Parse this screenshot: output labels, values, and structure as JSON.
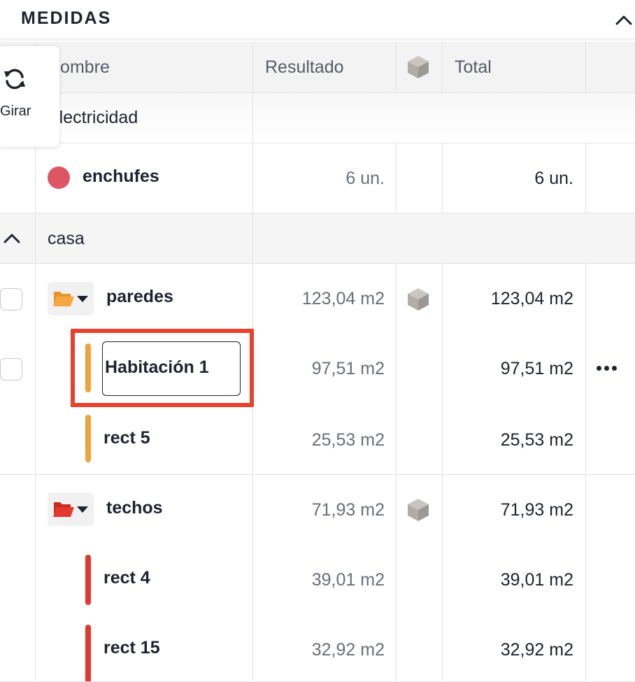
{
  "panel": {
    "title": "MEDIDAS"
  },
  "toolbar": {
    "rotate_label": "Girar"
  },
  "columns": {
    "name": "Nombre",
    "result": "Resultado",
    "total": "Total"
  },
  "groups": [
    {
      "label": "Electricidad",
      "items": [
        {
          "name": "enchufes",
          "result": "6 un.",
          "total": "6 un.",
          "color": "#de5563"
        }
      ]
    },
    {
      "label": "casa",
      "folders": [
        {
          "name": "paredes",
          "result": "123,04 m2",
          "total": "123,04 m2",
          "color": "#f0a33a",
          "children": [
            {
              "name": "Habitación 1",
              "result": "97,51 m2",
              "total": "97,51 m2"
            },
            {
              "name": "rect 5",
              "result": "25,53 m2",
              "total": "25,53 m2"
            }
          ]
        },
        {
          "name": "techos",
          "result": "71,93 m2",
          "total": "71,93 m2",
          "color": "#e3382d",
          "children": [
            {
              "name": "rect 4",
              "result": "39,01 m2",
              "total": "39,01 m2"
            },
            {
              "name": "rect 15",
              "result": "32,92 m2",
              "total": "32,92 m2"
            }
          ]
        }
      ]
    }
  ],
  "colors": {
    "highlight": "#e8412c",
    "text": "#1f2230",
    "muted": "#6a6e78",
    "cube": "#b0aca7"
  }
}
